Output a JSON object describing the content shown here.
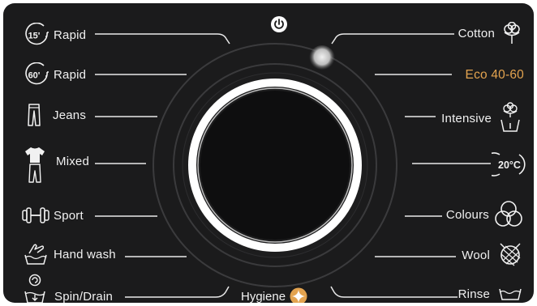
{
  "panel": {
    "accent_color": "#e3a34f",
    "text_color": "#f1f1f1",
    "background": "#1b1b1c"
  },
  "power": {
    "icon": "power-icon"
  },
  "programs_left": [
    {
      "label": "Rapid",
      "badge": "15'",
      "icon": "15-min-timer-icon"
    },
    {
      "label": "Rapid",
      "badge": "60'",
      "icon": "60-min-timer-icon"
    },
    {
      "label": "Jeans",
      "icon": "jeans-icon"
    },
    {
      "label": "Mixed",
      "icon": "mixed-clothes-icon"
    },
    {
      "label": "Sport",
      "icon": "dumbbell-icon"
    },
    {
      "label": "Hand wash",
      "icon": "hand-wash-icon"
    },
    {
      "label": "Spin/Drain",
      "icon": "spin-drain-icon"
    }
  ],
  "programs_right": [
    {
      "label": "Cotton",
      "icon": "cotton-flower-icon"
    },
    {
      "label": "Eco 40-60",
      "icon": "",
      "selected": true
    },
    {
      "label": "Intensive",
      "icon": "intensive-tub-icon"
    },
    {
      "label": "",
      "badge": "20°C",
      "icon": "20c-icon"
    },
    {
      "label": "Colours",
      "icon": "colours-circles-icon"
    },
    {
      "label": "Wool",
      "icon": "wool-ball-icon"
    },
    {
      "label": "Rinse",
      "icon": "rinse-tub-icon"
    }
  ],
  "bottom": {
    "label": "Hygiene",
    "icon": "hygiene-star-icon"
  }
}
